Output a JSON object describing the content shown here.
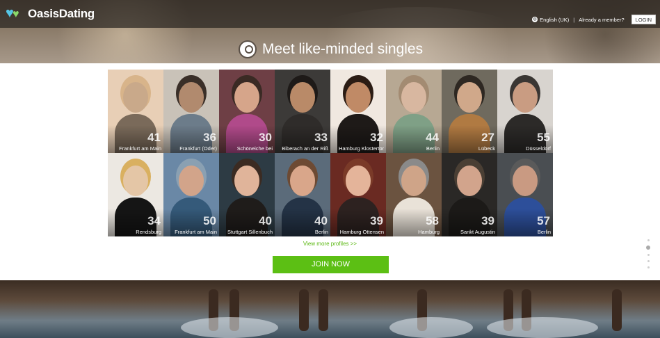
{
  "header": {
    "logo_text": "OasisDating",
    "language": "English (UK)",
    "member_prompt": "Already a member?",
    "login_label": "LOGIN",
    "headline": "Meet like-minded singles"
  },
  "profiles": [
    {
      "age": "41",
      "city": "Frankfurt am Main"
    },
    {
      "age": "36",
      "city": "Frankfurt (Oder)"
    },
    {
      "age": "30",
      "city": "Schöneiche bei"
    },
    {
      "age": "33",
      "city": "Biberach an der Riß"
    },
    {
      "age": "32",
      "city": "Hamburg Klostertor"
    },
    {
      "age": "44",
      "city": "Berlin"
    },
    {
      "age": "27",
      "city": "Lübeck"
    },
    {
      "age": "55",
      "city": "Düsseldorf"
    },
    {
      "age": "34",
      "city": "Rendsburg"
    },
    {
      "age": "50",
      "city": "Frankfurt am Main"
    },
    {
      "age": "40",
      "city": "Stuttgart Sillenbuch"
    },
    {
      "age": "40",
      "city": "Berlin"
    },
    {
      "age": "39",
      "city": "Hamburg Ottensen"
    },
    {
      "age": "58",
      "city": "Hamburg"
    },
    {
      "age": "39",
      "city": "Sankt Augustin"
    },
    {
      "age": "57",
      "city": "Berlin"
    }
  ],
  "actions": {
    "view_more": "View more profiles >>",
    "join_label": "JOIN NOW"
  },
  "colors": {
    "accent_green": "#5cbf14",
    "link_green": "#5bb812",
    "logo_blue": "#55c6e6"
  }
}
